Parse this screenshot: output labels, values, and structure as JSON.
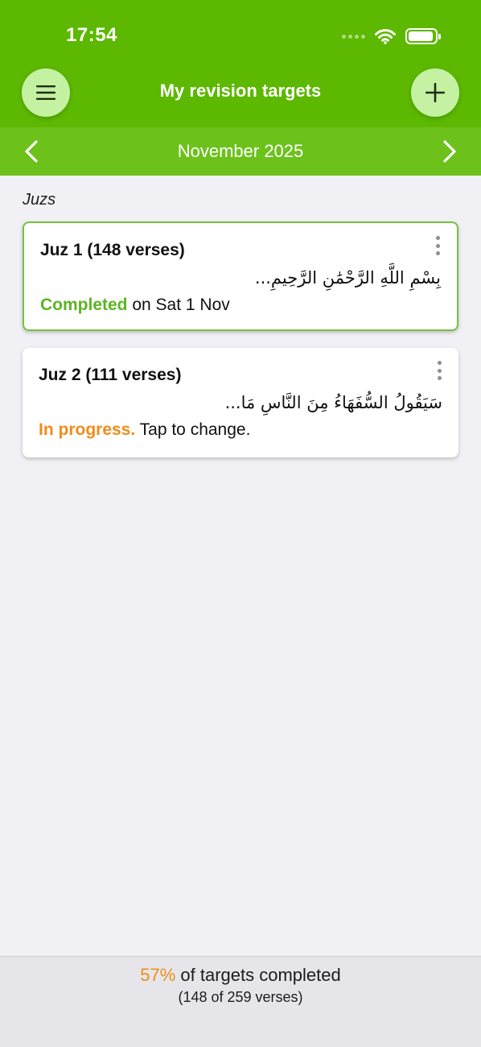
{
  "status_bar": {
    "time": "17:54"
  },
  "header": {
    "title": "My revision targets"
  },
  "month_nav": {
    "month": "November 2025"
  },
  "section": {
    "label": "Juzs"
  },
  "cards": [
    {
      "title": "Juz 1 (148 verses)",
      "arabic": "بِسْمِ اللَّهِ الرَّحْمَٰنِ الرَّحِيمِ...",
      "status_label": "Completed",
      "status_rest": " on Sat 1 Nov"
    },
    {
      "title": "Juz 2 (111 verses)",
      "arabic": "سَيَقُولُ السُّفَهَاءُ مِنَ النَّاسِ مَا...",
      "status_label": "In progress.",
      "status_rest": " Tap to change."
    }
  ],
  "footer": {
    "percent": "57%",
    "line1_rest": " of targets completed",
    "line2": "(148 of 259 verses)"
  },
  "colors": {
    "header_green": "#5cb800",
    "month_bar_green": "#6cc11b",
    "completed_green": "#5bb521",
    "progress_orange": "#f08c1a"
  },
  "icons": {
    "menu": "hamburger-icon",
    "add": "plus-icon",
    "prev": "chevron-left-icon",
    "next": "chevron-right-icon",
    "card_menu": "vertical-ellipsis-icon"
  }
}
